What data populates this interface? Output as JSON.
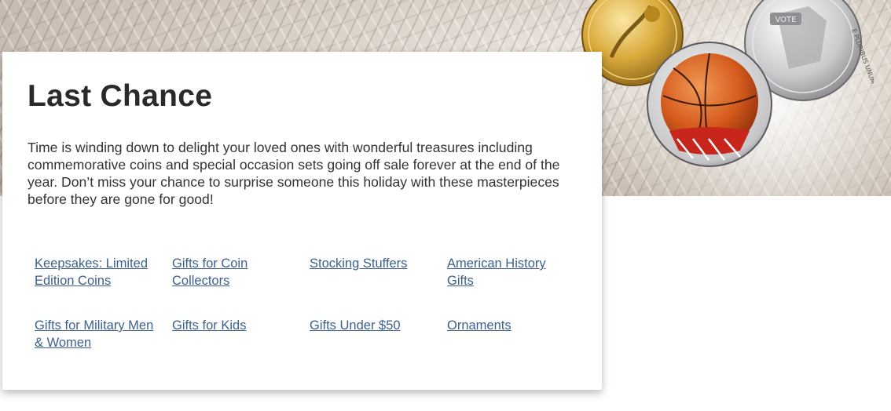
{
  "hero": {
    "coins": [
      {
        "icon": "gold-basketball-coin"
      },
      {
        "icon": "silver-liberty-coin",
        "motto_text": "E PLURIBUS UNUM"
      },
      {
        "icon": "colorized-basketball-coin"
      }
    ]
  },
  "card": {
    "title": "Last Chance",
    "description": "Time is winding down to delight your loved ones with wonderful treasures including commemorative coins and special occasion sets going off sale forever at the end of the year. Don’t miss your chance to surprise someone this holiday with these masterpieces before they are gone for good!",
    "links": [
      {
        "label": "Keepsakes: Limited Edition Coins"
      },
      {
        "label": "Gifts for Coin Collectors"
      },
      {
        "label": "Stocking Stuffers"
      },
      {
        "label": "American History Gifts"
      },
      {
        "label": "Gifts for Military Men & Women"
      },
      {
        "label": "Gifts for Kids"
      },
      {
        "label": "Gifts Under $50"
      },
      {
        "label": "Ornaments"
      }
    ]
  },
  "colors": {
    "link": "#3b5f8f",
    "title": "#2a2a2a",
    "body_text": "#333333"
  }
}
